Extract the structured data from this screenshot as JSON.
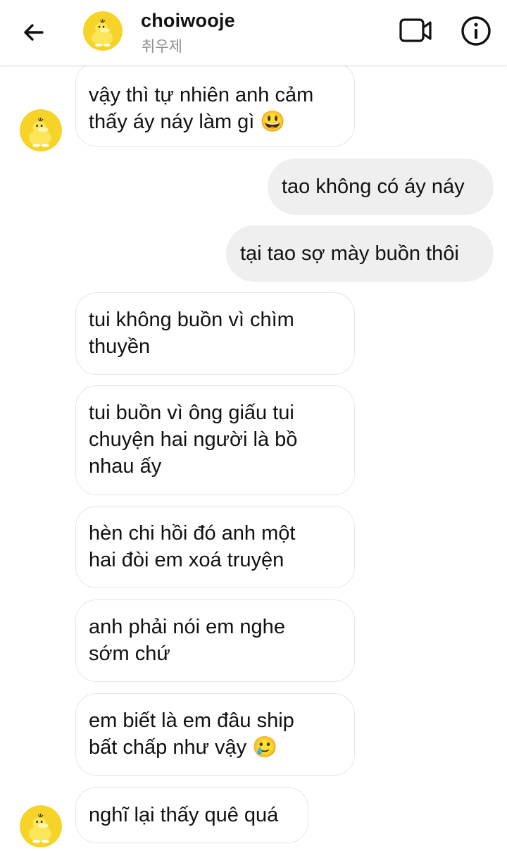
{
  "header": {
    "username": "choiwooje",
    "subtitle": "취우제",
    "back_icon": "back-arrow-icon",
    "video_icon": "video-call-icon",
    "info_icon": "info-icon",
    "avatar_color": "#f5d327"
  },
  "messages": [
    {
      "sender": "them",
      "text": "vậy thì tự nhiên anh cảm\nthấy áy náy làm gì 😃"
    },
    {
      "sender": "me",
      "text": "tao không có áy náy"
    },
    {
      "sender": "me",
      "text": "tại tao sợ mày buồn thôi"
    },
    {
      "sender": "them",
      "text": "tui không buồn vì chìm\nthuyền"
    },
    {
      "sender": "them",
      "text": "tui buồn vì ông giấu tui\nchuyện hai người là bồ\nnhau ấy"
    },
    {
      "sender": "them",
      "text": "hèn chi hồi đó anh một\nhai đòi em xoá truyện"
    },
    {
      "sender": "them",
      "text": "anh phải nói em nghe\nsớm chứ"
    },
    {
      "sender": "them",
      "text": "em biết là em đâu ship\nbất chấp như vậy 🥲"
    },
    {
      "sender": "them",
      "text": "nghĩ lại thấy quê quá"
    }
  ],
  "colors": {
    "outgoing_bubble": "#efefef",
    "incoming_border": "#e6e6e6",
    "secondary_text": "#8e8e8e"
  }
}
